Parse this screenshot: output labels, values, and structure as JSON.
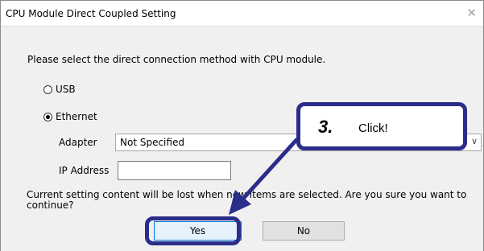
{
  "window": {
    "title": "CPU Module Direct Coupled Setting",
    "close_glyph": "✕"
  },
  "dialog": {
    "prompt": "Please select the direct connection method with CPU module.",
    "options": [
      {
        "label": "USB",
        "selected": false
      },
      {
        "label": "Ethernet",
        "selected": true
      }
    ],
    "adapter_label": "Adapter",
    "adapter_value": "Not Specified",
    "ip_label": "IP Address",
    "ip_value": "",
    "warning": "Current setting content will be lost when new items are selected. Are you sure you want to continue?",
    "yes_label": "Yes",
    "no_label": "No"
  },
  "annotation": {
    "step": "3.",
    "text": "Click!",
    "color": "#2b2d8a"
  }
}
